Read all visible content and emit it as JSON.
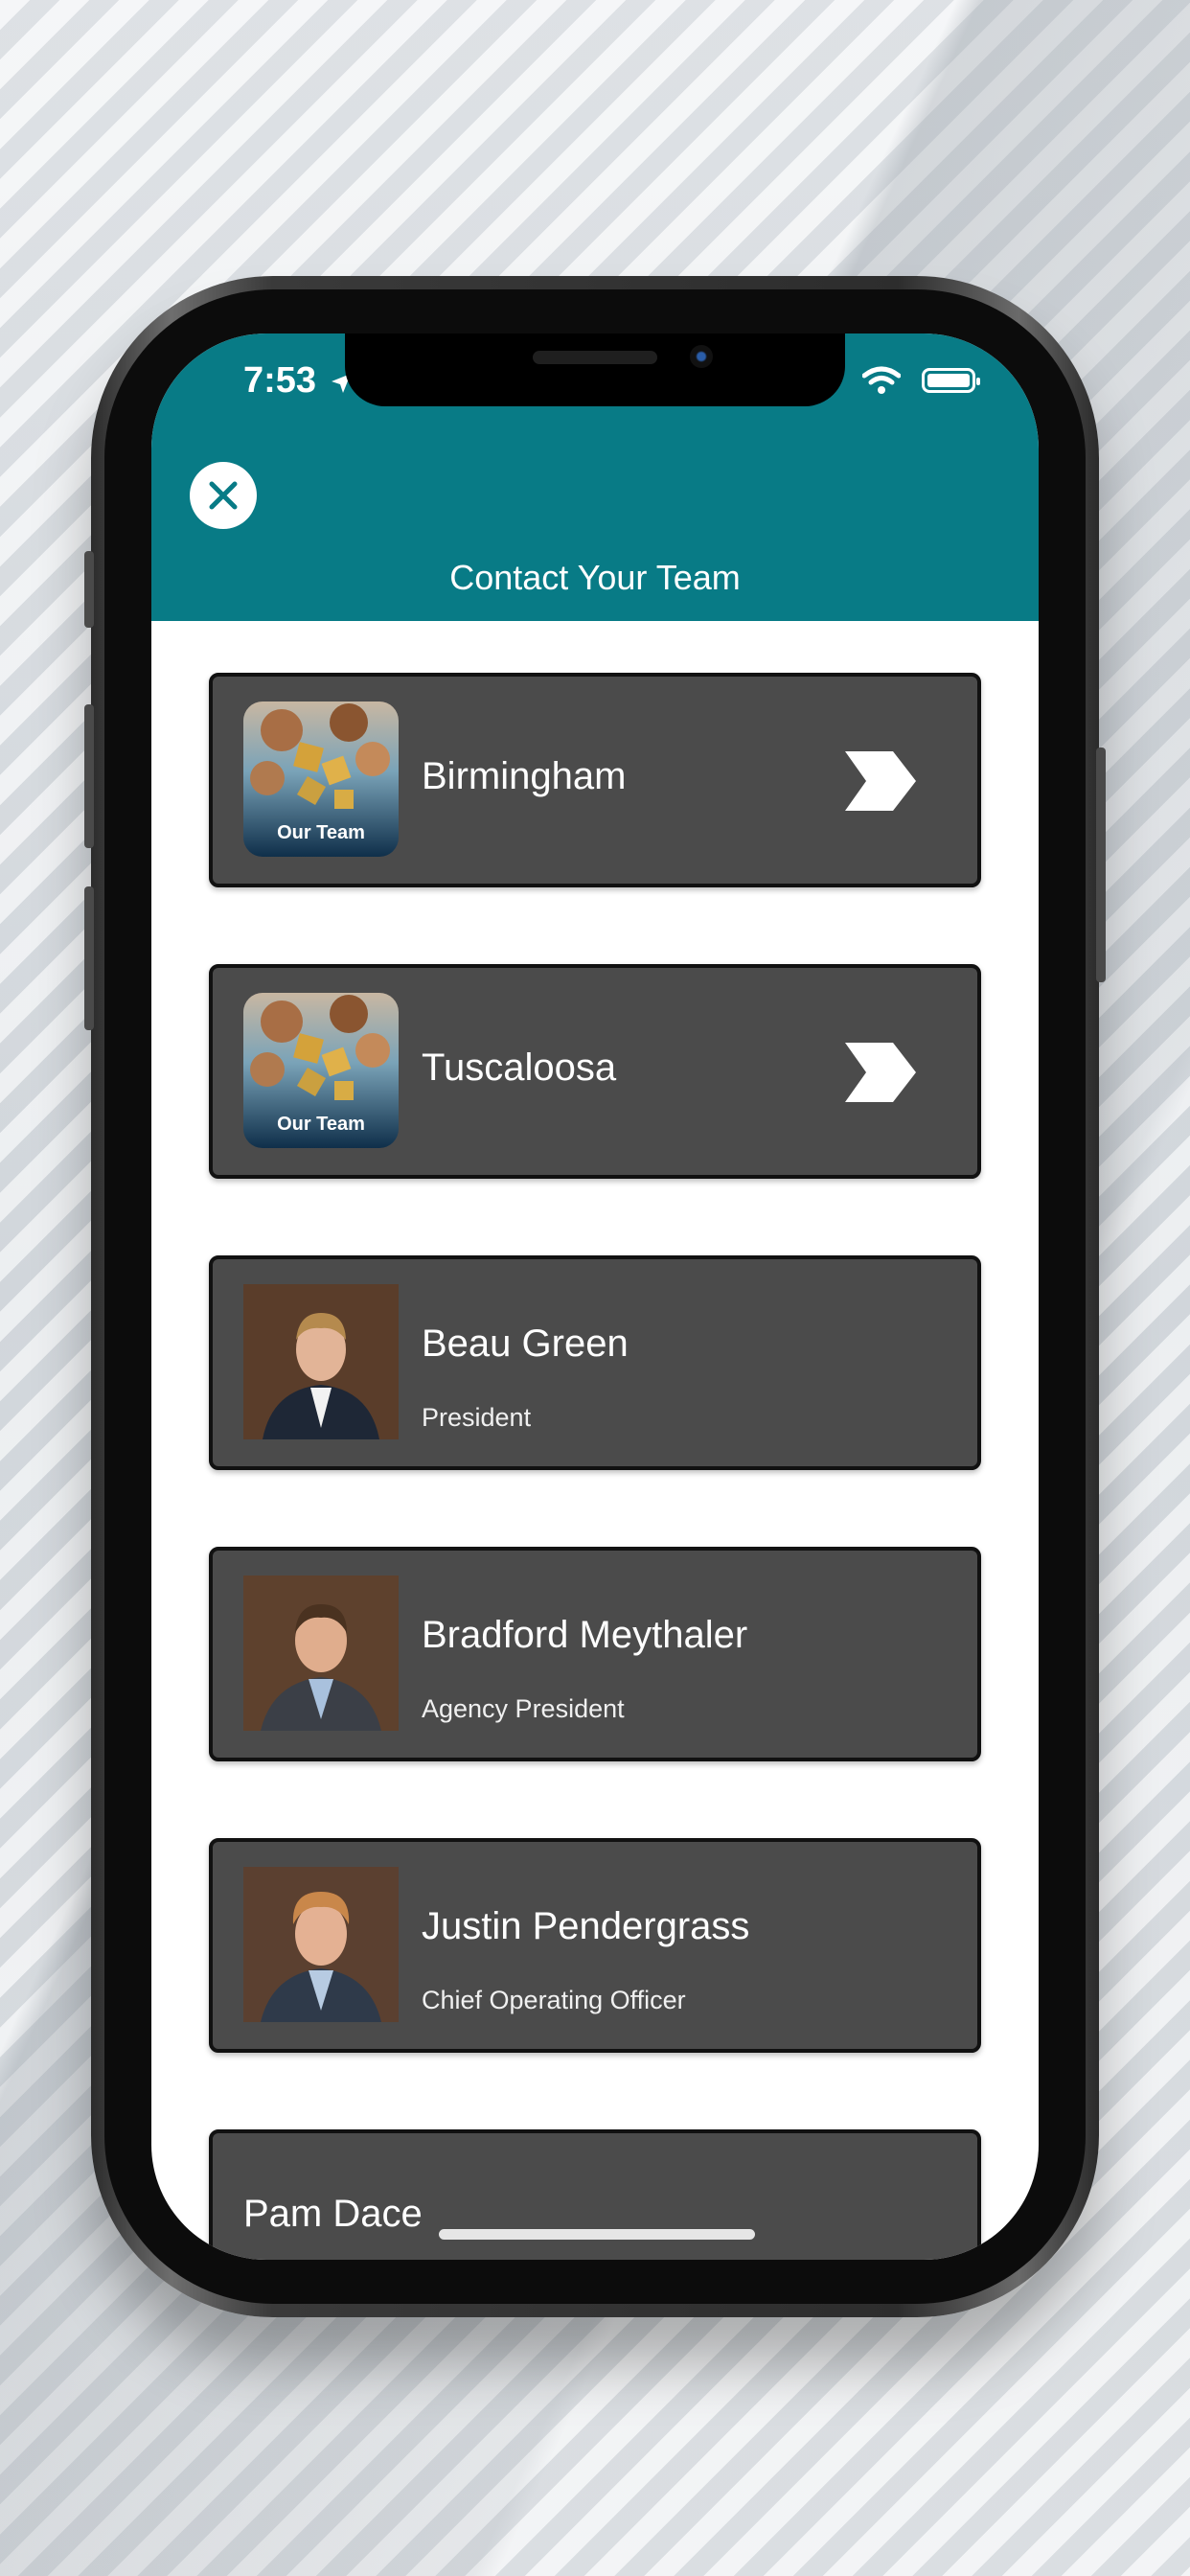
{
  "status_bar": {
    "time": "7:53"
  },
  "header": {
    "title": "Contact Your Team"
  },
  "groups": [
    {
      "name": "Birmingham",
      "thumb_label": "Our Team"
    },
    {
      "name": "Tuscaloosa",
      "thumb_label": "Our Team"
    }
  ],
  "people": [
    {
      "name": "Beau Green",
      "title": "President"
    },
    {
      "name": "Bradford Meythaler",
      "title": "Agency President"
    },
    {
      "name": "Justin Pendergrass",
      "title": "Chief Operating Officer"
    },
    {
      "name": "Pam Dace"
    }
  ],
  "colors": {
    "header": "#087b86",
    "card": "#4b4b4b"
  }
}
